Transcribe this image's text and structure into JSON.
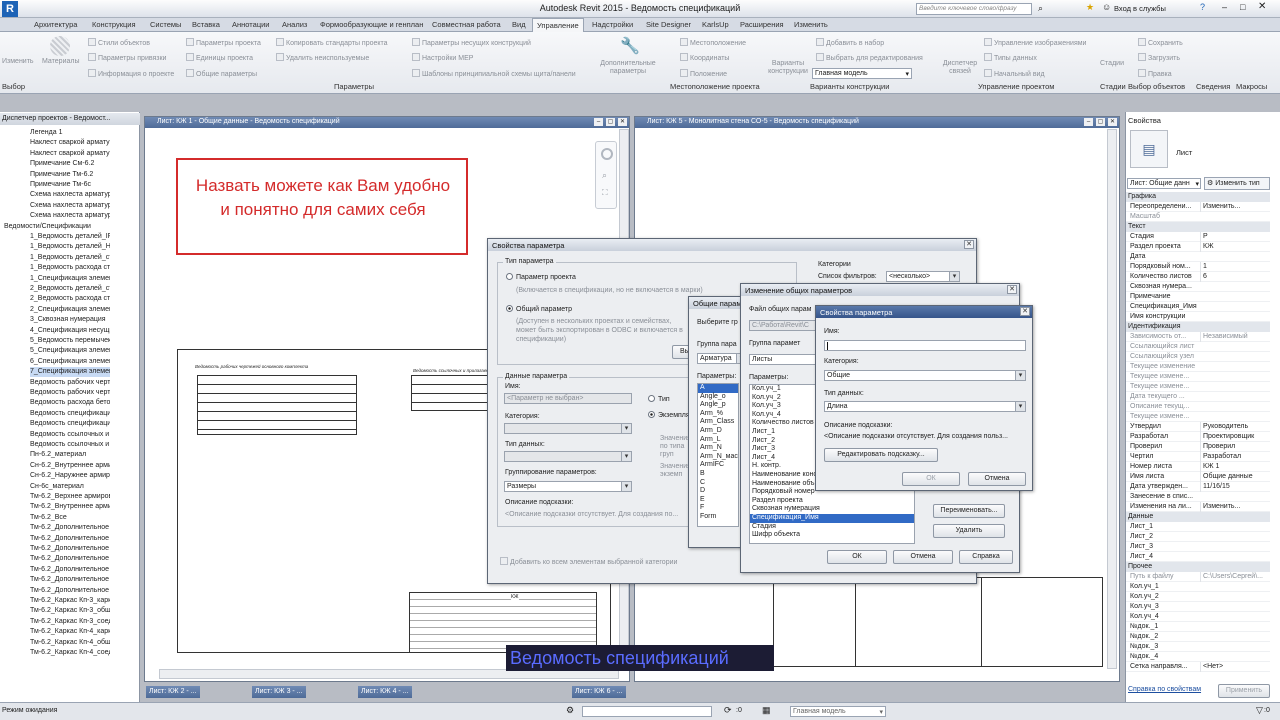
{
  "app": {
    "title": "Autodesk Revit 2015 -  Ведомость спецификаций",
    "search_placeholder": "Введите ключевое слово/фразу",
    "login": "Вход в службы"
  },
  "tabs": [
    "Архитектура",
    "Конструкция",
    "Системы",
    "Вставка",
    "Аннотации",
    "Анализ",
    "Формообразующие и генплан",
    "Совместная работа",
    "Вид",
    "Управление",
    "Надстройки",
    "Site Designer",
    "KarlsUp",
    "Расширения",
    "Изменить"
  ],
  "ribbon": {
    "modify": "Изменить",
    "materials": "Материалы",
    "col1": [
      "Стили объектов",
      "Параметры привязки",
      "Информация о проекте"
    ],
    "col2": [
      "Параметры проекта",
      "Единицы проекта",
      "Общие параметры"
    ],
    "col3": [
      "Копировать стандарты проекта",
      "Удалить неиспользуемые"
    ],
    "col4": [
      "Параметры несущих конструкций",
      "Настройки MEP",
      "Шаблоны принципиальной схемы щита/панели"
    ],
    "extra": "Дополнительные параметры",
    "loc": [
      "Местоположение",
      "Координаты",
      "Положение"
    ],
    "variants": "Варианты конструкции",
    "var_items": [
      "Добавить в набор",
      "Выбрать для редактирования"
    ],
    "main_model": "Главная модель",
    "dispatcher": "Диспетчер связей",
    "links": [
      "Управление изображениями",
      "Типы данных",
      "Начальный вид"
    ],
    "phases": "Стадии",
    "sel": [
      "Сохранить",
      "Загрузить",
      "Правка"
    ],
    "panels": [
      "Выбор",
      "Параметры",
      "Местоположение проекта",
      "Варианты конструкции",
      "Управление проектом",
      "Стадии",
      "Выбор объектов",
      "Сведения",
      "Макросы"
    ]
  },
  "browser": {
    "title": "Диспетчер проектов - Ведомост...",
    "items": [
      "Легенда 1",
      "Наклест сваркой арматурных",
      "Наклест сваркой арматуры",
      "Примечание См-6.2",
      "Примечание Тм-6.2",
      "Примечание Тм-6с",
      "Схема нахлеста арматурных",
      "Схема нахлеста арматурных",
      "Схема нахлеста арматуры",
      "Ведомости/Спецификации",
      "1_Ведомость деталей_IFC",
      "1_Ведомость деталей_НЕ ст",
      "1_Ведомость деталей_станд",
      "1_Ведомость расхода стали",
      "1_Спецификация элементов а",
      "2_Ведомость деталей_сталь",
      "2_Ведомость расхода стали",
      "2_Спецификация элементов",
      "3_Сквозная нумерация",
      "4_Спецификация несущих ко",
      "5_Ведомость перемычек",
      "5_Спецификация элементов",
      "6_Спецификация элементов",
      "7_Спецификация элементов",
      "Ведомость рабочих чертеже",
      "Ведомость рабочих чертеже",
      "Ведомость расхода бетона",
      "Ведомость спецификаций от",
      "Ведомость спецификаций от",
      "Ведомость ссылочных и при",
      "Ведомость ссылочных и при",
      "Пн-6.2_материал",
      "Сн-6.2_Внутреннее армиров",
      "Сн-6.2_Наружнее армирова",
      "Сн-6с_материал",
      "Тм-6.2_Верхнее армировани",
      "Тм-6.2_Внутреннее армиров",
      "Тм-6.2_Все",
      "Тм-6.2_Дополнительное арм",
      "Тм-6.2_Дополнительное арм",
      "Тм-6.2_Дополнительное арм",
      "Тм-6.2_Дополнительное арм",
      "Тм-6.2_Дополнительное арм",
      "Тм-6.2_Дополнительное арм",
      "Тм-6.2_Дополнительное арм",
      "Тм-6.2_Каркас Кп-3_каркасы",
      "Тм-6.2_Каркас Кп-3_общая п",
      "Тм-6.2_Каркас Кп-3_соедин",
      "Тм-6.2_Каркас Кп-4_каркасы",
      "Тм-6.2_Каркас Кп-4_общая п",
      "Тм-6.2_Каркас Кп-4_соедин"
    ]
  },
  "view1": {
    "title": "Лист: КЖ 1 - Общие данные - Ведомость спецификаций",
    "note": "Назвать можете как Вам удобно и понятно для самих себя",
    "sheet_title1": "Ведомость рабочих чертежей основного комплекта",
    "sheet_title2": "Ведомость ссылочных и прилагаемых документов",
    "sheet_code": "КЖ"
  },
  "view2": {
    "title": "Лист: КЖ 5 - Монолитная стена СО-5 - Ведомость спецификаций"
  },
  "dlg1": {
    "title": "Свойства параметра",
    "type_group": "Тип параметра",
    "r1": "Параметр проекта",
    "r1_note": "(Включается в спецификации, но не включается в марки)",
    "r2": "Общий параметр",
    "r2_note": "(Доступен в нескольких проектах и семействах, может быть экспортирован в ODBC и включается в спецификации)",
    "select_btn": "Выбрать...",
    "data_group": "Данные параметра",
    "name_label": "Имя:",
    "name_val": "<Параметр не выбран>",
    "cat_label": "Категория:",
    "dtype_label": "Тип данных:",
    "grp_label": "Группирование параметров:",
    "grp_val": "Размеры",
    "desc_label": "Описание подсказки:",
    "desc_val": "<Описание подсказки отсутствует. Для создания по...",
    "type_r": "Тип",
    "inst_r": "Экземпляр",
    "val1": "Значения  по  типа  груп",
    "val2": "Значения экземп",
    "categories": "Категории",
    "filter_label": "Список фильтров:",
    "filter_val": "<несколько>",
    "chk": "Добавить ко всем элементам выбранной категории"
  },
  "dlg2": {
    "title": "Общие параметры",
    "select": "Выберите гр",
    "group_label": "Группа пара",
    "group_val": "Арматура",
    "params_label": "Параметры:",
    "params": [
      "A",
      "Angle_o",
      "Angle_p",
      "Arm_%",
      "Arm_Class",
      "Arm_D",
      "Arm_L",
      "Arm_N",
      "Arm_N_масс",
      "ArmIFC",
      "B",
      "C",
      "D",
      "E",
      "F",
      "Form"
    ]
  },
  "dlg3": {
    "title": "Изменение общих параметров",
    "file_label": "Файл общих парам",
    "file_val": "C:\\Работа\\Revit\\C",
    "group_label": "Группа парамет",
    "group_val": "Листы",
    "params_label": "Параметры:",
    "params": [
      "Кол.уч_1",
      "Кол.уч_2",
      "Кол.уч_3",
      "Кол.уч_4",
      "Количество листов",
      "Лист_1",
      "Лист_2",
      "Лист_3",
      "Лист_4",
      "Н. контр.",
      "Наименование конс",
      "Наименование объ",
      "Порядковый номер",
      "Раздел проекта",
      "Сквозная нумерация",
      "Спецификация_Имя",
      "Стадия",
      "Шифр объекта"
    ],
    "btn_rename": "Переименовать...",
    "btn_delete": "Удалить",
    "ok": "ОК",
    "cancel": "Отмена",
    "help": "Справка"
  },
  "dlg4": {
    "title": "Свойства параметра",
    "name_label": "Имя:",
    "name_val": "",
    "cat_label": "Категория:",
    "cat_val": "Общие",
    "dtype_label": "Тип данных:",
    "dtype_val": "Длина",
    "desc_label": "Описание подсказки:",
    "desc_val": "<Описание подсказки отсутствует. Для создания польз...",
    "edit_btn": "Редактировать подсказку...",
    "ok": "ОК",
    "cancel": "Отмена"
  },
  "props": {
    "title": "Свойства",
    "type": "Лист",
    "selector": "Лист: Общие данн",
    "edit_type": "Изменить тип",
    "sections": {
      "graphics": "Графика",
      "text": "Текст",
      "ident": "Идентификация",
      "data": "Данные",
      "other": "Прочее"
    },
    "g_rows": [
      [
        "Переопределени...",
        "Изменить..."
      ],
      [
        "Масштаб",
        ""
      ]
    ],
    "t_rows": [
      [
        "Стадия",
        "Р"
      ],
      [
        "Раздел проекта",
        "КЖ"
      ],
      [
        "Дата",
        ""
      ],
      [
        "Порядковый ном...",
        "1"
      ],
      [
        "Количество листов",
        "6"
      ],
      [
        "Сквозная нумера...",
        ""
      ],
      [
        "Примечание",
        ""
      ],
      [
        "Спецификация_Имя",
        ""
      ],
      [
        "Имя конструкции",
        ""
      ]
    ],
    "i_rows": [
      [
        "Зависимость от...",
        "Независимый"
      ],
      [
        "Ссылающийся лист",
        ""
      ],
      [
        "Ссылающийся узел",
        ""
      ],
      [
        "Текущее изменение",
        ""
      ],
      [
        "Текущее измене...",
        ""
      ],
      [
        "Текущее измене...",
        ""
      ],
      [
        "Дата текущего ...",
        ""
      ],
      [
        "Описание текущ...",
        ""
      ],
      [
        "Текущее измене...",
        ""
      ],
      [
        "Утвердил",
        "Руководитель"
      ],
      [
        "Разработал",
        "Проектировщик"
      ],
      [
        "Проверил",
        "Проверил"
      ],
      [
        "Чертил",
        "Разработал"
      ],
      [
        "Номер листа",
        "КЖ 1"
      ],
      [
        "Имя листа",
        "Общие данные"
      ],
      [
        "Дата утвержден...",
        "11/16/15"
      ],
      [
        "Занесение в спис...",
        ""
      ],
      [
        "Изменения на ли...",
        "Изменить..."
      ]
    ],
    "d_rows": [
      [
        "Лист_1",
        ""
      ],
      [
        "Лист_2",
        ""
      ],
      [
        "Лист_3",
        ""
      ],
      [
        "Лист_4",
        ""
      ]
    ],
    "o_rows": [
      [
        "Путь к файлу",
        "C:\\Users\\Сергей\\..."
      ],
      [
        "Кол.уч_1",
        ""
      ],
      [
        "Кол.уч_2",
        ""
      ],
      [
        "Кол.уч_3",
        ""
      ],
      [
        "Кол.уч_4",
        ""
      ],
      [
        "№док._1",
        ""
      ],
      [
        "№док._2",
        ""
      ],
      [
        "№док._3",
        ""
      ],
      [
        "№док._4",
        ""
      ],
      [
        "Сетка направля...",
        "<Нет>"
      ]
    ],
    "help_link": "Справка по свойствам",
    "apply": "Применить"
  },
  "view_tabs": [
    "Лист: КЖ 2 - ...",
    "Лист: КЖ 3 - ...",
    "Лист: КЖ 4 - ...",
    "Лист: КЖ 6 - ..."
  ],
  "caption": "Ведомость спецификаций",
  "status": {
    "text": "Режим ожидания",
    "model": "Главная модель",
    "zero": ":0"
  },
  "colors": {
    "accent": "#35548a",
    "note_border": "#d42b2b",
    "note_text": "#d42b2b",
    "caption_bg": "#1c1c34",
    "caption_text": "#5a6cff"
  }
}
